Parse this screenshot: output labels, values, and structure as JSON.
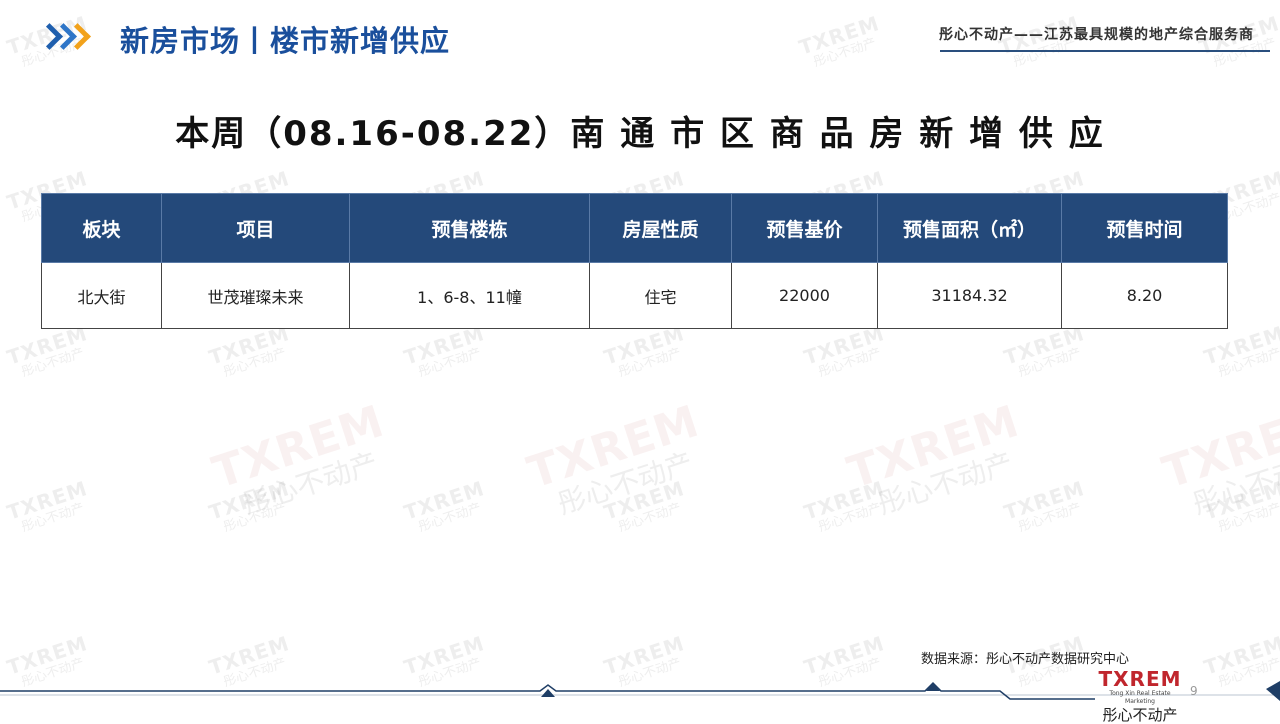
{
  "header": {
    "title": "新房市场丨楼市新增供应",
    "tagline": "彤心不动产——江苏最具规模的地产综合服务商"
  },
  "main_title": "本周（08.16-08.22）南 通 市 区 商 品 房 新 增 供 应",
  "table": {
    "headers": [
      "板块",
      "项目",
      "预售楼栋",
      "房屋性质",
      "预售基价",
      "预售面积（㎡）",
      "预售时间"
    ],
    "rows": [
      [
        "北大街",
        "世茂璀璨未来",
        "1、6-8、11幢",
        "住宅",
        "22000",
        "31184.32",
        "8.20"
      ]
    ]
  },
  "footer": {
    "source": "数据来源：彤心不动产数据研究中心",
    "page_number": "9",
    "logo_en": "TXREM",
    "logo_sub": "Tong Xin Real Estate Marketing",
    "logo_cn": "彤心不动产"
  },
  "watermark": {
    "en": "TXREM",
    "cn": "彤心不动产"
  },
  "colors": {
    "header_blue": "#1a4f9c",
    "table_header_bg": "#24497a",
    "accent_orange": "#f2a21b",
    "logo_red": "#c0262d"
  }
}
